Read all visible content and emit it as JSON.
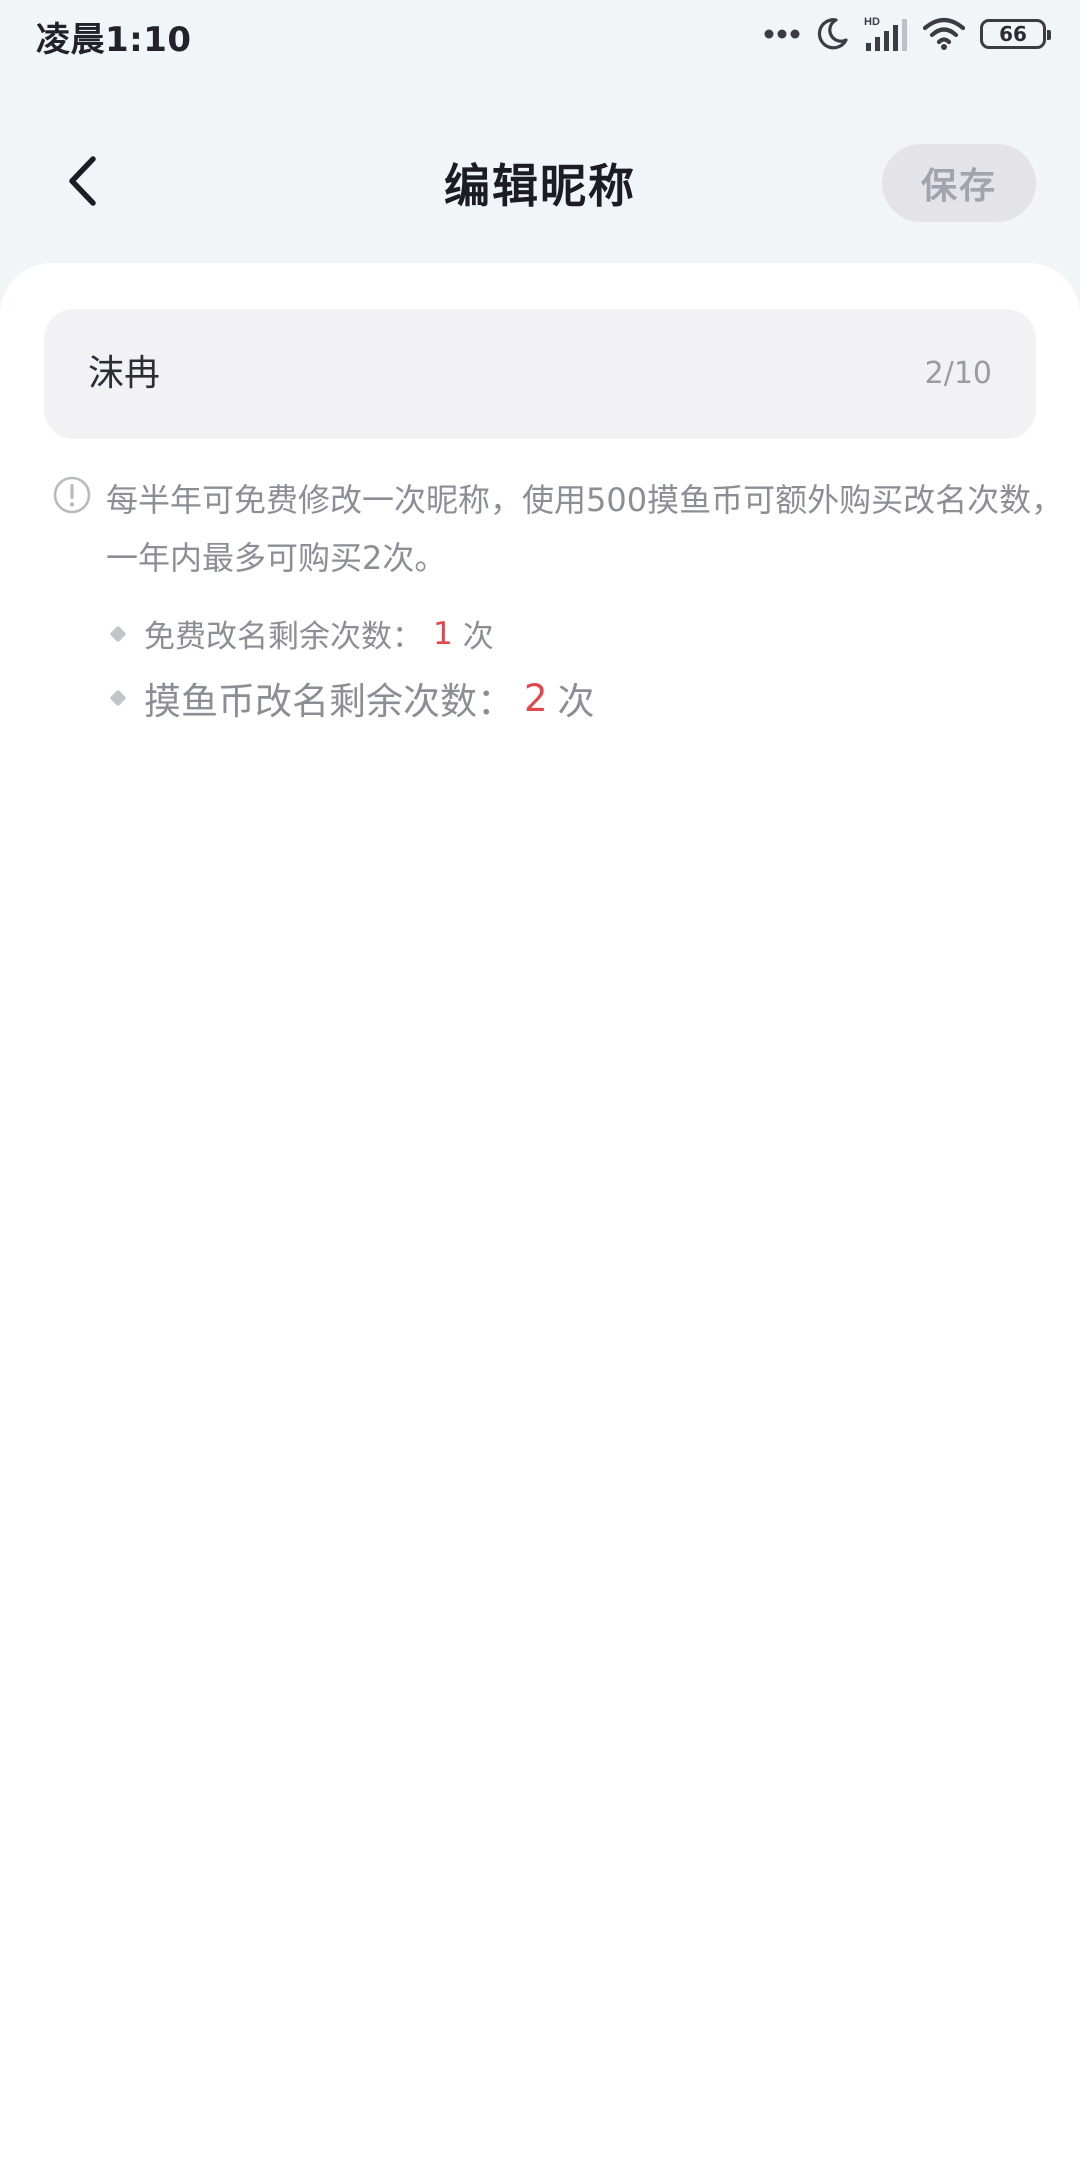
{
  "status_bar": {
    "time": "凌晨1:10",
    "battery": "66",
    "icons": [
      "more-dots-icon",
      "moon-icon",
      "hd-signal-icon",
      "wifi-icon",
      "battery-icon"
    ]
  },
  "header": {
    "title": "编辑昵称",
    "save_label": "保存",
    "back_icon": "chevron-left-icon"
  },
  "nickname": {
    "value": "沫冉",
    "counter": "2/10"
  },
  "notice": {
    "icon": "info-circle-icon",
    "text": "每半年可免费修改一次昵称，使用500摸鱼币可额外购买改名次数，一年内最多可购买2次。",
    "items": [
      {
        "label": "免费改名剩余次数：",
        "count": "1",
        "unit": "次"
      },
      {
        "label": "摸鱼币改名剩余次数：",
        "count": "2",
        "unit": "次"
      }
    ]
  },
  "colors": {
    "accent_red": "#e0484a",
    "muted_text": "#8d8d96",
    "save_bg": "#e3e3e8"
  }
}
